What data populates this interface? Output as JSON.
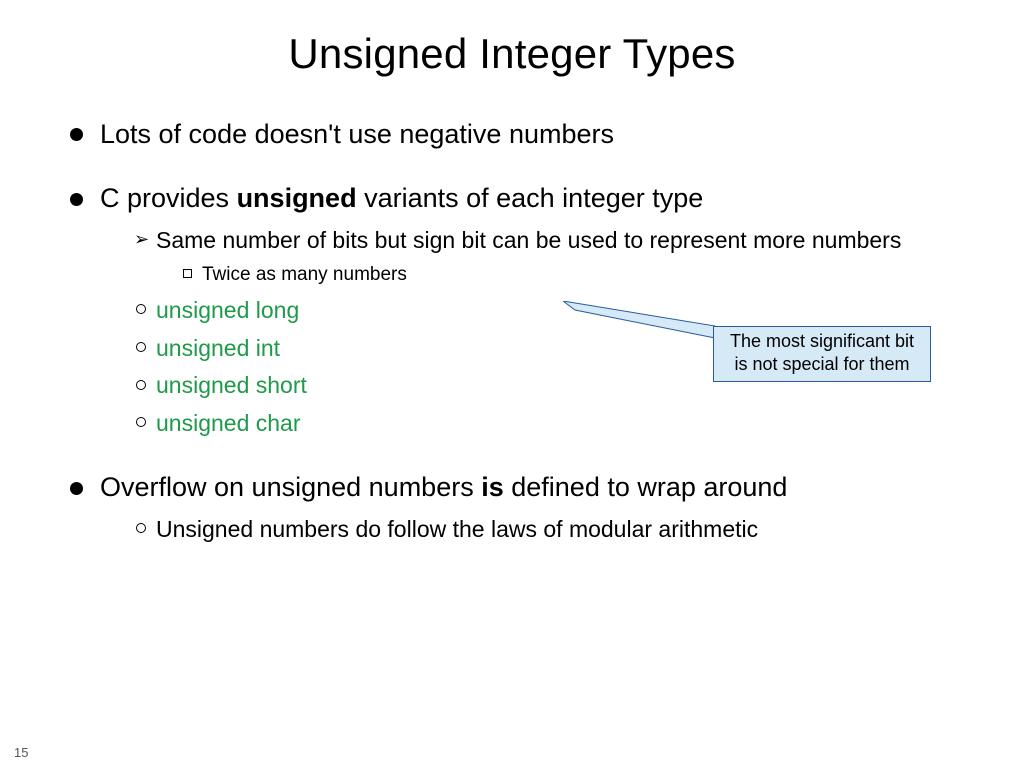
{
  "slide": {
    "title": "Unsigned Integer Types",
    "page_number": "15",
    "bullets": [
      {
        "text": "Lots of code doesn't use negative numbers"
      },
      {
        "segments": [
          {
            "t": "C provides "
          },
          {
            "t": "unsigned",
            "bold": true
          },
          {
            "t": " variants of each integer type"
          }
        ],
        "sub": [
          {
            "type": "arrow",
            "text": "Same number of bits but sign bit can be used to represent more numbers",
            "sub": [
              {
                "type": "square",
                "text": "Twice as many numbers"
              }
            ]
          },
          {
            "type": "circle",
            "green": true,
            "text": "unsigned long"
          },
          {
            "type": "circle",
            "green": true,
            "text": "unsigned int"
          },
          {
            "type": "circle",
            "green": true,
            "text": "unsigned short"
          },
          {
            "type": "circle",
            "green": true,
            "text": "unsigned char"
          }
        ]
      },
      {
        "segments": [
          {
            "t": "Overflow on unsigned numbers "
          },
          {
            "t": "is",
            "bold": true
          },
          {
            "t": " defined to wrap around"
          }
        ],
        "sub": [
          {
            "type": "circle",
            "text": "Unsigned numbers do follow the laws of modular arithmetic"
          }
        ]
      }
    ],
    "callout": {
      "line1": "The most significant bit",
      "line2": "is not special for them"
    }
  }
}
